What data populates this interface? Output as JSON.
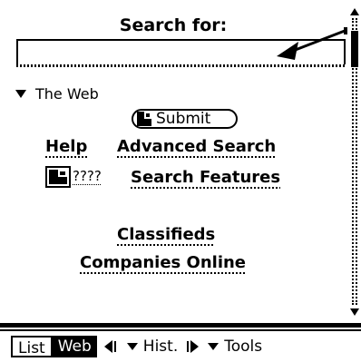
{
  "search": {
    "heading": "Search for:",
    "query_value": ""
  },
  "scope": {
    "selected": "The Web"
  },
  "buttons": {
    "submit_label": "Submit"
  },
  "links": {
    "help": "Help",
    "advanced_search": "Advanced Search",
    "search_features": "Search Features",
    "features_shortcut": "????",
    "classifieds": "Classifieds",
    "companies_online": "Companies Online"
  },
  "toolbar": {
    "list_label": "List",
    "web_label": "Web",
    "history_label": "Hist.",
    "tools_label": "Tools"
  },
  "icons": [
    "pointer-arrow-icon",
    "dropdown-triangle-icon",
    "submit-graphic-icon",
    "feature-graphic-icon",
    "back-arrow-icon",
    "forward-arrow-icon",
    "scroll-up-icon",
    "scroll-down-icon"
  ]
}
